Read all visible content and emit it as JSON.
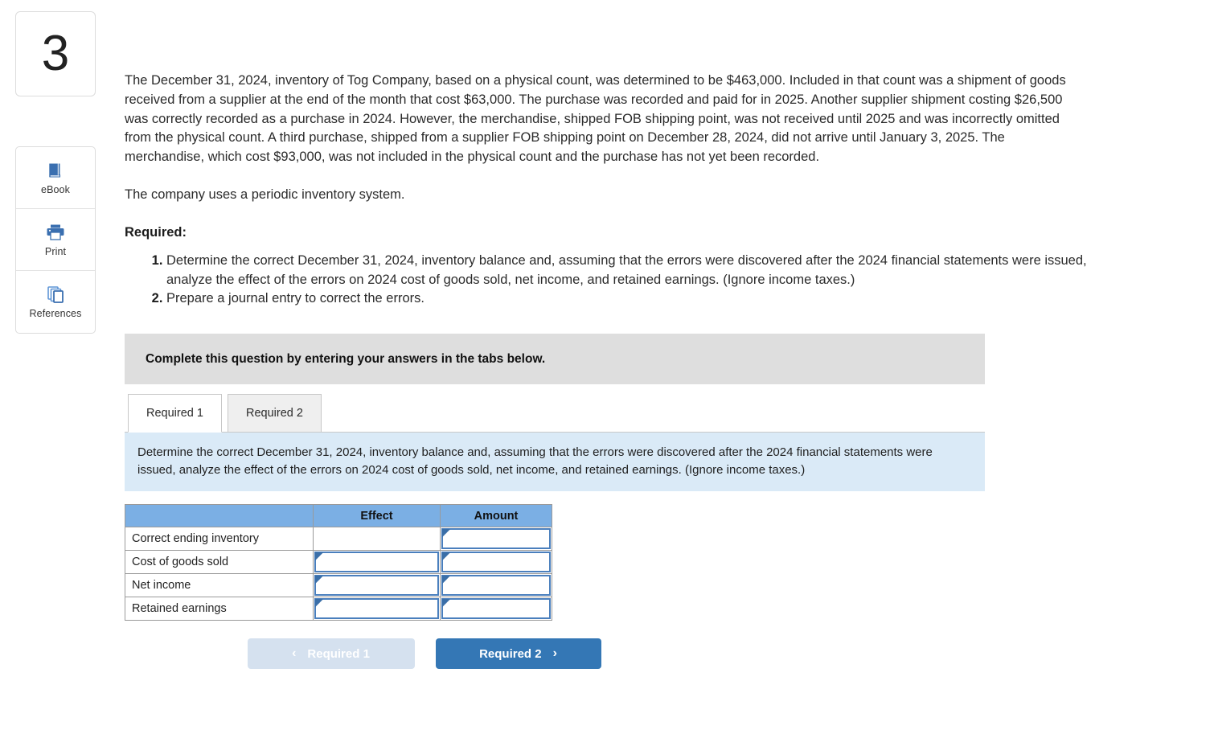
{
  "question": {
    "number": "3",
    "paragraph_1": "The December 31, 2024, inventory of Tog Company, based on a physical count, was determined to be $463,000. Included in that count was a shipment of goods received from a supplier at the end of the month that cost $63,000. The purchase was recorded and paid for in 2025. Another supplier shipment costing $26,500 was correctly recorded as a purchase in 2024. However, the merchandise, shipped FOB shipping point, was not received until 2025 and was incorrectly omitted from the physical count. A third purchase, shipped from a supplier FOB shipping point on December 28, 2024, did not arrive until January 3, 2025. The merchandise, which cost $93,000, was not included in the physical count and the purchase has not yet been recorded.",
    "paragraph_2": "The company uses a periodic inventory system.",
    "required_heading": "Required:",
    "required_items": [
      "Determine the correct December 31, 2024, inventory balance and, assuming that the errors were discovered after the 2024 financial statements were issued, analyze the effect of the errors on 2024 cost of goods sold, net income, and retained earnings. (Ignore income taxes.)",
      "Prepare a journal entry to correct the errors."
    ]
  },
  "toolbar": {
    "items": [
      {
        "label": "eBook",
        "icon": "book-icon"
      },
      {
        "label": "Print",
        "icon": "printer-icon"
      },
      {
        "label": "References",
        "icon": "copy-pages-icon"
      }
    ]
  },
  "instruction_bar": {
    "text": "Complete this question by entering your answers in the tabs below."
  },
  "tabs": [
    {
      "label": "Required 1",
      "active": true
    },
    {
      "label": "Required 2",
      "active": false
    }
  ],
  "info_panel": {
    "text": "Determine the correct December 31, 2024, inventory balance and, assuming that the errors were discovered after the 2024 financial statements were issued, analyze the effect of the errors on 2024 cost of goods sold, net income, and retained earnings. (Ignore income taxes.)"
  },
  "answer_table": {
    "headers": [
      "",
      "Effect",
      "Amount"
    ],
    "rows": [
      {
        "label": "Correct ending inventory",
        "effect_value": "",
        "effect_input": false,
        "amount_value": "",
        "amount_input": true
      },
      {
        "label": "Cost of goods sold",
        "effect_value": "",
        "effect_input": true,
        "amount_value": "",
        "amount_input": true
      },
      {
        "label": "Net income",
        "effect_value": "",
        "effect_input": true,
        "amount_value": "",
        "amount_input": true
      },
      {
        "label": "Retained earnings",
        "effect_value": "",
        "effect_input": true,
        "amount_value": "",
        "amount_input": true
      }
    ]
  },
  "nav": {
    "prev_label": "Required 1",
    "prev_chevron": "‹",
    "next_label": "Required 2",
    "next_chevron": "›"
  },
  "colors": {
    "table_header_blue": "#7bafe4",
    "primary_blue": "#3477b5",
    "disabled_blue": "#d5e1ef",
    "info_panel_blue": "#daeaf7",
    "instruction_gray": "#dedede",
    "input_border_blue": "#4a7fbd",
    "icon_blue": "#3a6fb0"
  }
}
